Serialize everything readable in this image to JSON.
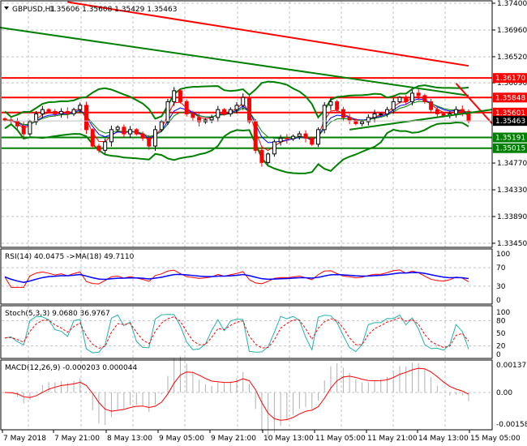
{
  "header": {
    "symbol_label": "GBPUSD,H1",
    "ohlc": "1.35606 1.35608 1.35429 1.35463"
  },
  "colors": {
    "bull": "#000000",
    "bear": "#ff0000",
    "band": "#008000",
    "level_red": "#ff0000",
    "level_green": "#008000",
    "grid": "#c0c0c0"
  },
  "price_axis": {
    "max": 1.374,
    "min": 1.3345,
    "ticks": [
      "1.37400",
      "1.36960",
      "1.36520",
      "1.36090",
      "1.34770",
      "1.34330",
      "1.33890",
      "1.33450"
    ],
    "current": "1.35463"
  },
  "levels": [
    {
      "value": 1.3617,
      "label": "1.36170",
      "color": "#ff0000"
    },
    {
      "value": 1.35848,
      "label": "1.35848",
      "color": "#ff0000"
    },
    {
      "value": 1.35601,
      "label": "1.35601",
      "color": "#ff0000"
    },
    {
      "value": 1.35191,
      "label": "1.35191",
      "color": "#008000"
    },
    {
      "value": 1.35015,
      "label": "1.35015",
      "color": "#008000"
    }
  ],
  "long_ma": [
    {
      "color": "#ff0000",
      "from": 1.3742,
      "to": 1.3637,
      "start_index": 10
    },
    {
      "color": "#008000",
      "from": 1.37,
      "to": 1.3588,
      "start_index": 0
    }
  ],
  "trendlines": [
    {
      "color": "#ff0000",
      "from_index": 72,
      "from": 1.3608,
      "to_index": 83,
      "to": 1.3542
    },
    {
      "color": "#008000",
      "from_index": 55,
      "from": 1.3532,
      "to_index": 83,
      "to": 1.3565
    }
  ],
  "chart_data": {
    "type": "candlestick",
    "title": "GBPUSD,H1",
    "closes": [
      1.3548,
      1.3546,
      1.3538,
      1.3525,
      1.3545,
      1.3558,
      1.3565,
      1.3562,
      1.3558,
      1.3562,
      1.3558,
      1.3565,
      1.3572,
      1.3532,
      1.3505,
      1.3498,
      1.3512,
      1.3532,
      1.3536,
      1.3525,
      1.3532,
      1.3525,
      1.3518,
      1.3505,
      1.3532,
      1.3545,
      1.3578,
      1.3596,
      1.3578,
      1.3558,
      1.3552,
      1.3545,
      1.3548,
      1.3552,
      1.3565,
      1.3558,
      1.3565,
      1.3572,
      1.3585,
      1.3545,
      1.3498,
      1.3478,
      1.3492,
      1.3512,
      1.3518,
      1.3517,
      1.3521,
      1.3525,
      1.3518,
      1.3508,
      1.3532,
      1.3572,
      1.3578,
      1.3565,
      1.3552,
      1.3548,
      1.3542,
      1.3545,
      1.3552,
      1.3558,
      1.3558,
      1.3565,
      1.3578,
      1.3585,
      1.3578,
      1.3592,
      1.3588,
      1.3578,
      1.3565,
      1.3558,
      1.3555,
      1.3558,
      1.3565,
      1.3562,
      1.3546
    ],
    "x_labels": [
      "7 May 2018",
      "7 May 21:00",
      "8 May 13:00",
      "9 May 05:00",
      "9 May 21:00",
      "10 May 13:00",
      "11 May 05:00",
      "11 May 21:00",
      "14 May 13:00",
      "15 May 05:00"
    ]
  },
  "rsi": {
    "label": "RSI(14) 40.0475  ->MA(18) 49.7110",
    "ticks": [
      "100",
      "70",
      "30",
      "0"
    ]
  },
  "stoch": {
    "label": "Stoch(5,3,3) 9.0680 36.9767",
    "ticks": [
      "100",
      "80",
      "50",
      "20",
      "0"
    ]
  },
  "macd": {
    "label": "MACD(12,26,9) -0.000203 0.000044",
    "ticks": [
      "0.001375",
      "0.00",
      "-0.001587"
    ]
  }
}
